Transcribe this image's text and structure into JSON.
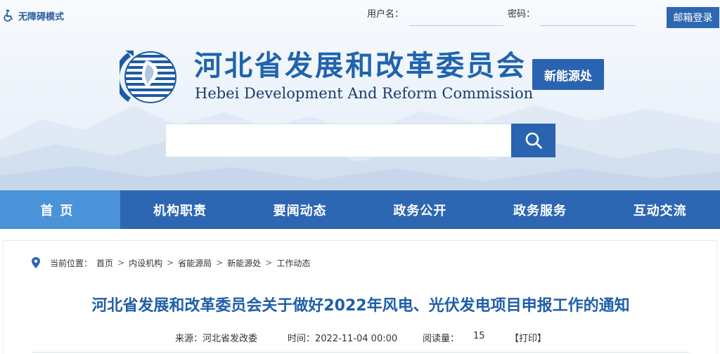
{
  "header": {
    "accessibility_label": "无障碍模式",
    "username_label": "用户名：",
    "password_label": "密码：",
    "mail_login_label": "邮箱登录",
    "logo_cn": "河北省发展和改革委员会",
    "logo_en": "Hebei Development And Reform Commission",
    "sub_badge": "新能源处",
    "search_placeholder": ""
  },
  "nav": {
    "items": [
      {
        "label": "首页",
        "active": true
      },
      {
        "label": "机构职责",
        "active": false
      },
      {
        "label": "要闻动态",
        "active": false
      },
      {
        "label": "政务公开",
        "active": false
      },
      {
        "label": "政务服务",
        "active": false
      },
      {
        "label": "互动交流",
        "active": false
      }
    ]
  },
  "breadcrumb": {
    "lead": "当前位置：",
    "items": [
      "首页",
      "内设机构",
      "省能源局",
      "新能源处",
      "工作动态"
    ],
    "separator": ">"
  },
  "article": {
    "title": "河北省发展和改革委员会关于做好2022年风电、光伏发电项目申报工作的通知",
    "source": "来源：河北省发改委",
    "time": "时间：2022-11-04 00:00",
    "views_label": "阅读量：",
    "views": "15",
    "print_label": "【打印】"
  },
  "colors": {
    "primary": "#2d67b3",
    "nav_active": "#4a93d9",
    "title": "#1f5ea8"
  }
}
